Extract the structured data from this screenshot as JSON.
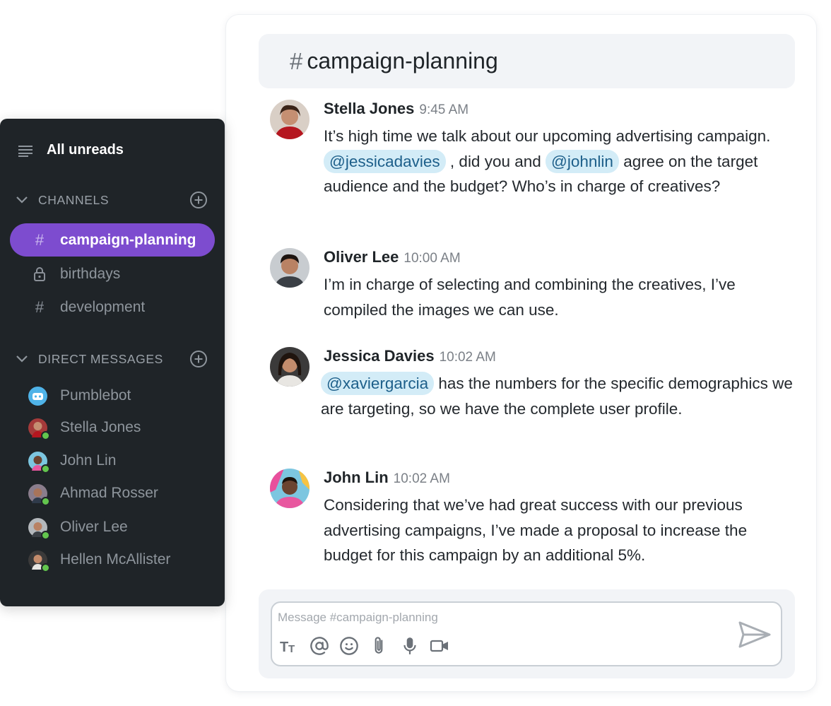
{
  "sidebar": {
    "all_unreads": "All unreads",
    "channels_header": "CHANNELS",
    "channels": [
      {
        "label": "campaign-planning",
        "icon": "hash-icon",
        "active": true
      },
      {
        "label": "birthdays",
        "icon": "lock-icon",
        "active": false
      },
      {
        "label": "development",
        "icon": "hash-icon",
        "active": false
      }
    ],
    "dm_header": "DIRECT MESSAGES",
    "direct_messages": [
      {
        "label": "Pumblebot",
        "online": false
      },
      {
        "label": "Stella Jones",
        "online": true
      },
      {
        "label": "John Lin",
        "online": true
      },
      {
        "label": "Ahmad Rosser",
        "online": true
      },
      {
        "label": "Oliver Lee",
        "online": true
      },
      {
        "label": "Hellen McAllister",
        "online": true
      }
    ]
  },
  "channel": {
    "hash": "#",
    "name": "campaign-planning"
  },
  "messages": [
    {
      "author": "Stella Jones",
      "time": "9:45 AM",
      "segments": {
        "t1": "It’s high time we talk about our upcoming advertising campaign.",
        "m1": "@jessicadavies",
        "t2": ", did you and",
        "m2": "@johnlin",
        "t3": "agree on the target audience and the budget? Who’s in charge of creatives?"
      }
    },
    {
      "author": "Oliver Lee",
      "time": "10:00 AM",
      "text": "I’m in charge of selecting and combining the creatives, I’ve compiled the images we can use."
    },
    {
      "author": "Jessica Davies",
      "time": "10:02 AM",
      "segments": {
        "m1": "@xaviergarcia",
        "t1": "has the numbers for the specific demographics we are targeting, so we have the complete user profile."
      }
    },
    {
      "author": "John Lin",
      "time": "10:02 AM",
      "text": "Considering that we’ve had great success with our previous advertising campaigns, I’ve made a proposal to increase the budget for this campaign by an additional 5%."
    }
  ],
  "composer": {
    "placeholder": "Message #campaign-planning",
    "tools": [
      "text-format-icon",
      "mention-icon",
      "emoji-icon",
      "attachment-icon",
      "microphone-icon",
      "video-icon"
    ],
    "send_icon": "send-icon"
  },
  "colors": {
    "sidebar_bg": "#1f2428",
    "active_channel": "#7d4ccf",
    "mention_bg": "#d3ecf7",
    "online": "#63c54e"
  }
}
